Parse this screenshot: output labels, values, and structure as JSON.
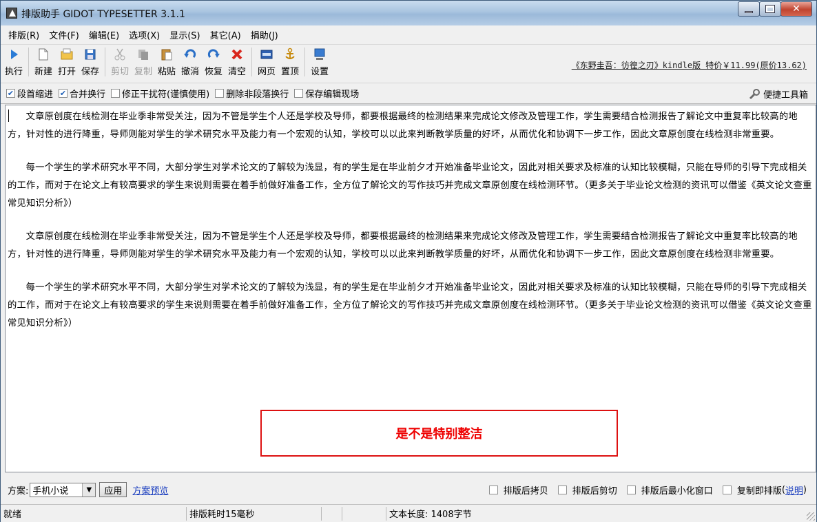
{
  "window": {
    "title": "排版助手 GIDOT TYPESETTER 3.1.1"
  },
  "menu": [
    "排版(R)",
    "文件(F)",
    "编辑(E)",
    "选项(X)",
    "显示(S)",
    "其它(A)",
    "捐助(J)"
  ],
  "toolbar": {
    "buttons": [
      {
        "label": "执行",
        "icon": "play-icon",
        "enabled": true
      },
      {
        "label": "新建",
        "icon": "new-file-icon",
        "enabled": true
      },
      {
        "label": "打开",
        "icon": "open-folder-icon",
        "enabled": true
      },
      {
        "label": "保存",
        "icon": "save-icon",
        "enabled": true
      },
      {
        "label": "剪切",
        "icon": "scissors-icon",
        "enabled": false
      },
      {
        "label": "复制",
        "icon": "copy-icon",
        "enabled": false
      },
      {
        "label": "粘贴",
        "icon": "paste-icon",
        "enabled": true
      },
      {
        "label": "撤消",
        "icon": "undo-icon",
        "enabled": true
      },
      {
        "label": "恢复",
        "icon": "redo-icon",
        "enabled": true
      },
      {
        "label": "清空",
        "icon": "clear-icon",
        "enabled": true
      },
      {
        "label": "网页",
        "icon": "html-icon",
        "enabled": true
      },
      {
        "label": "置顶",
        "icon": "pin-top-icon",
        "enabled": true
      },
      {
        "label": "设置",
        "icon": "monitor-settings-icon",
        "enabled": true
      }
    ],
    "promo": "《东野圭吾：彷徨之刃》kindle版 特价￥11.99(原价13.62)"
  },
  "options": {
    "items": [
      {
        "label": "段首缩进",
        "checked": true
      },
      {
        "label": "合并换行",
        "checked": true
      },
      {
        "label": "修正干扰符(谨慎使用)",
        "checked": false
      },
      {
        "label": "删除非段落换行",
        "checked": false
      },
      {
        "label": "保存编辑现场",
        "checked": false
      }
    ],
    "toolbox": "便捷工具箱"
  },
  "editor": {
    "paragraphs": [
      "文章原创度在线检测在毕业季非常受关注，因为不管是学生个人还是学校及导师，都要根据最终的检测结果来完成论文修改及管理工作，学生需要结合检测报告了解论文中重复率比较高的地方，针对性的进行降重，导师则能对学生的学术研究水平及能力有一个宏观的认知，学校可以以此来判断教学质量的好坏，从而优化和协调下一步工作，因此文章原创度在线检测非常重要。",
      "每一个学生的学术研究水平不同，大部分学生对学术论文的了解较为浅显，有的学生是在毕业前夕才开始准备毕业论文，因此对相关要求及标准的认知比较模糊，只能在导师的引导下完成相关的工作，而对于在论文上有较高要求的学生来说则需要在着手前做好准备工作，全方位了解论文的写作技巧并完成文章原创度在线检测环节。（更多关于毕业论文检测的资讯可以借鉴《英文论文查重常见知识分析》）",
      "文章原创度在线检测在毕业季非常受关注，因为不管是学生个人还是学校及导师，都要根据最终的检测结果来完成论文修改及管理工作，学生需要结合检测报告了解论文中重复率比较高的地方，针对性的进行降重，导师则能对学生的学术研究水平及能力有一个宏观的认知，学校可以以此来判断教学质量的好坏，从而优化和协调下一步工作，因此文章原创度在线检测非常重要。",
      "每一个学生的学术研究水平不同，大部分学生对学术论文的了解较为浅显，有的学生是在毕业前夕才开始准备毕业论文，因此对相关要求及标准的认知比较模糊，只能在导师的引导下完成相关的工作，而对于在论文上有较高要求的学生来说则需要在着手前做好准备工作，全方位了解论文的写作技巧并完成文章原创度在线检测环节。（更多关于毕业论文检测的资讯可以借鉴《英文论文查重常见知识分析》）"
    ],
    "highlight": "是不是特别整洁"
  },
  "scheme": {
    "label": "方案:",
    "selected": "手机小说",
    "apply": "应用",
    "preview": "方案预览",
    "after": [
      {
        "label": "排版后拷贝",
        "checked": false
      },
      {
        "label": "排版后剪切",
        "checked": false
      },
      {
        "label": "排版后最小化窗口",
        "checked": false
      },
      {
        "label": "复制即排版",
        "checked": false
      }
    ],
    "help_open": "(",
    "help": "说明",
    "help_close": ")"
  },
  "status": {
    "state": "就绪",
    "timing": "排版耗时15毫秒",
    "length": "文本长度: 1408字节"
  },
  "colors": {
    "highlight_text": "#e00000",
    "highlight_border": "#d01010",
    "link": "#1c3fbf"
  }
}
